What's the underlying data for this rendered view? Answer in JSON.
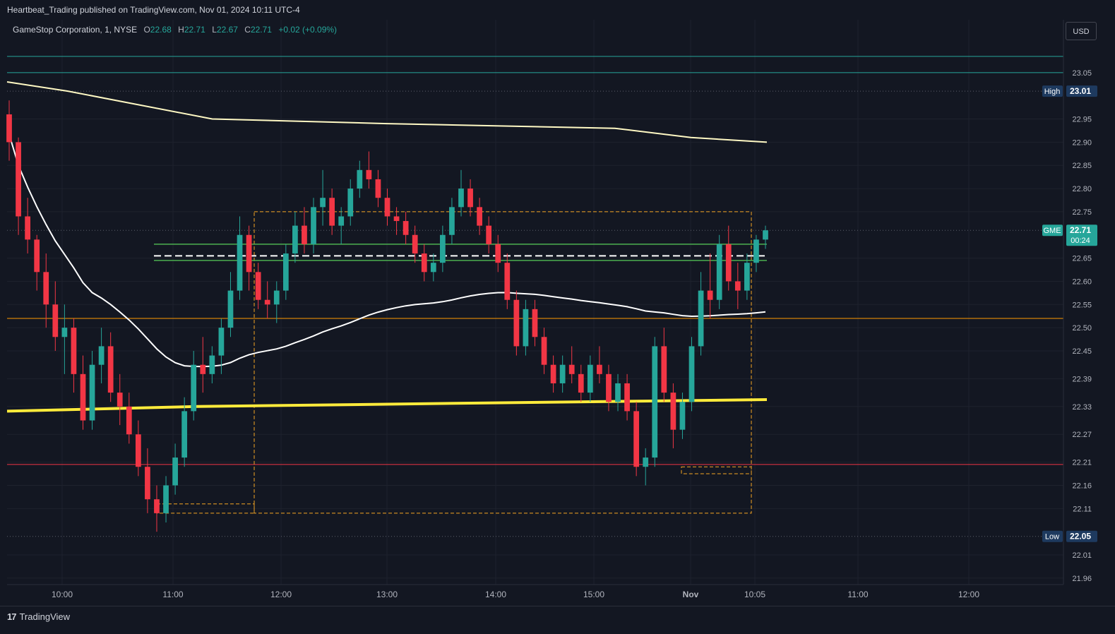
{
  "header": {
    "publisher_line": "Heartbeat_Trading published on TradingView.com, Nov 01, 2024 10:11 UTC-4"
  },
  "legend": {
    "symbol": "GameStop Corporation, 1, NYSE",
    "o_label": "O",
    "o_value": "22.68",
    "h_label": "H",
    "h_value": "22.71",
    "l_label": "L",
    "l_value": "22.67",
    "c_label": "C",
    "c_value": "22.71",
    "change": "+0.02 (+0.09%)"
  },
  "currency_button": "USD",
  "footer": {
    "brand": "TradingView",
    "logo_glyph": "17"
  },
  "colors": {
    "background": "#131722",
    "up": "#26a69a",
    "down": "#f23645",
    "vwap_white": "#ffffff",
    "ma_yellow": "#ffeb3b",
    "box_orange": "#f5a623",
    "support_green": "#4caf50",
    "level_orange": "#ff9800",
    "level_red": "#f23645",
    "level_teal": "#26a69a"
  },
  "chart_data": {
    "type": "candlestick",
    "symbol": "GME",
    "interval": "1",
    "ylim": [
      21.94,
      23.1
    ],
    "y_ticks": [
      "23.05",
      "22.95",
      "22.90",
      "22.85",
      "22.80",
      "22.75",
      "22.65",
      "22.60",
      "22.55",
      "22.50",
      "22.45",
      "22.39",
      "22.33",
      "22.27",
      "22.21",
      "22.16",
      "22.11",
      "22.01",
      "21.96"
    ],
    "x_ticks": [
      "10:00",
      "11:00",
      "12:00",
      "13:00",
      "14:00",
      "15:00",
      "Nov",
      "10:05",
      "11:00",
      "12:00"
    ],
    "price_tags": {
      "high": {
        "label": "High",
        "value": "23.01"
      },
      "last": {
        "label": "GME",
        "value": "22.71",
        "countdown": "00:24"
      },
      "low": {
        "label": "Low",
        "value": "22.05"
      }
    },
    "horizontal_levels": [
      {
        "price": 23.085,
        "color": "teal"
      },
      {
        "price": 23.05,
        "color": "teal"
      },
      {
        "price": 22.52,
        "color": "orange"
      },
      {
        "price": 22.205,
        "color": "red"
      }
    ],
    "support_zone": {
      "top": 22.68,
      "mid": 22.655,
      "bottom": 22.645
    },
    "boxes": [
      {
        "from": "10:50",
        "to": "11:45",
        "low": 22.1,
        "high": 22.12
      },
      {
        "from": "11:45",
        "to": "Nov 10:05",
        "low": 22.1,
        "high": 22.75
      },
      {
        "from": "15:55",
        "to": "Nov 10:05",
        "low": 22.185,
        "high": 22.2
      }
    ],
    "series": [
      {
        "type": "candles",
        "points": [
          [
            22.96,
            22.99,
            22.86,
            22.9
          ],
          [
            22.9,
            22.91,
            22.7,
            22.74
          ],
          [
            22.74,
            22.78,
            22.66,
            22.69
          ],
          [
            22.69,
            22.7,
            22.58,
            22.62
          ],
          [
            22.62,
            22.66,
            22.5,
            22.55
          ],
          [
            22.55,
            22.6,
            22.45,
            22.48
          ],
          [
            22.48,
            22.55,
            22.4,
            22.5
          ],
          [
            22.5,
            22.52,
            22.36,
            22.4
          ],
          [
            22.4,
            22.44,
            22.28,
            22.3
          ],
          [
            22.3,
            22.45,
            22.28,
            22.42
          ],
          [
            22.42,
            22.5,
            22.38,
            22.46
          ],
          [
            22.46,
            22.49,
            22.34,
            22.36
          ],
          [
            22.36,
            22.4,
            22.29,
            22.33
          ],
          [
            22.33,
            22.36,
            22.25,
            22.27
          ],
          [
            22.27,
            22.3,
            22.18,
            22.2
          ],
          [
            22.2,
            22.24,
            22.1,
            22.13
          ],
          [
            22.13,
            22.16,
            22.06,
            22.1
          ],
          [
            22.1,
            22.18,
            22.08,
            22.16
          ],
          [
            22.16,
            22.25,
            22.14,
            22.22
          ],
          [
            22.22,
            22.35,
            22.2,
            22.32
          ],
          [
            22.32,
            22.45,
            22.3,
            22.42
          ],
          [
            22.42,
            22.48,
            22.36,
            22.4
          ],
          [
            22.4,
            22.46,
            22.38,
            22.44
          ],
          [
            22.44,
            22.52,
            22.4,
            22.5
          ],
          [
            22.5,
            22.62,
            22.48,
            22.58
          ],
          [
            22.58,
            22.74,
            22.56,
            22.7
          ],
          [
            22.7,
            22.72,
            22.58,
            22.62
          ],
          [
            22.62,
            22.64,
            22.54,
            22.56
          ],
          [
            22.56,
            22.6,
            22.52,
            22.55
          ],
          [
            22.55,
            22.6,
            22.51,
            22.58
          ],
          [
            22.58,
            22.68,
            22.56,
            22.66
          ],
          [
            22.66,
            22.75,
            22.64,
            22.72
          ],
          [
            22.72,
            22.76,
            22.66,
            22.68
          ],
          [
            22.68,
            22.78,
            22.66,
            22.76
          ],
          [
            22.76,
            22.84,
            22.72,
            22.78
          ],
          [
            22.78,
            22.8,
            22.7,
            22.72
          ],
          [
            22.72,
            22.76,
            22.68,
            22.74
          ],
          [
            22.74,
            22.82,
            22.72,
            22.8
          ],
          [
            22.8,
            22.86,
            22.78,
            22.84
          ],
          [
            22.84,
            22.88,
            22.8,
            22.82
          ],
          [
            22.82,
            22.84,
            22.76,
            22.78
          ],
          [
            22.78,
            22.8,
            22.72,
            22.74
          ],
          [
            22.74,
            22.76,
            22.7,
            22.73
          ],
          [
            22.73,
            22.75,
            22.68,
            22.7
          ],
          [
            22.7,
            22.72,
            22.64,
            22.66
          ],
          [
            22.66,
            22.68,
            22.6,
            22.62
          ],
          [
            22.62,
            22.66,
            22.6,
            22.64
          ],
          [
            22.64,
            22.72,
            22.62,
            22.7
          ],
          [
            22.7,
            22.78,
            22.68,
            22.76
          ],
          [
            22.76,
            22.84,
            22.74,
            22.8
          ],
          [
            22.8,
            22.82,
            22.74,
            22.76
          ],
          [
            22.76,
            22.78,
            22.7,
            22.72
          ],
          [
            22.72,
            22.74,
            22.66,
            22.68
          ],
          [
            22.68,
            22.7,
            22.62,
            22.64
          ],
          [
            22.64,
            22.66,
            22.54,
            22.56
          ],
          [
            22.56,
            22.58,
            22.44,
            22.46
          ],
          [
            22.46,
            22.56,
            22.44,
            22.54
          ],
          [
            22.54,
            22.56,
            22.46,
            22.48
          ],
          [
            22.48,
            22.5,
            22.4,
            22.42
          ],
          [
            22.42,
            22.44,
            22.36,
            22.38
          ],
          [
            22.38,
            22.44,
            22.36,
            22.42
          ],
          [
            22.42,
            22.46,
            22.38,
            22.4
          ],
          [
            22.4,
            22.42,
            22.34,
            22.36
          ],
          [
            22.36,
            22.44,
            22.34,
            22.42
          ],
          [
            22.42,
            22.46,
            22.38,
            22.4
          ],
          [
            22.4,
            22.42,
            22.32,
            22.34
          ],
          [
            22.34,
            22.4,
            22.32,
            22.38
          ],
          [
            22.38,
            22.4,
            22.3,
            22.32
          ],
          [
            22.32,
            22.34,
            22.18,
            22.2
          ],
          [
            22.2,
            22.24,
            22.16,
            22.22
          ],
          [
            22.22,
            22.48,
            22.2,
            22.46
          ],
          [
            22.46,
            22.5,
            22.34,
            22.36
          ],
          [
            22.36,
            22.38,
            22.24,
            22.28
          ],
          [
            22.28,
            22.36,
            22.26,
            22.34
          ],
          [
            22.34,
            22.48,
            22.32,
            22.46
          ],
          [
            22.46,
            22.62,
            22.44,
            22.58
          ],
          [
            22.58,
            22.66,
            22.52,
            22.56
          ],
          [
            22.56,
            22.7,
            22.54,
            22.68
          ],
          [
            22.68,
            22.72,
            22.58,
            22.6
          ],
          [
            22.6,
            22.64,
            22.54,
            22.58
          ],
          [
            22.58,
            22.66,
            22.56,
            22.64
          ],
          [
            22.64,
            22.7,
            22.62,
            22.69
          ],
          [
            22.69,
            22.72,
            22.67,
            22.71
          ]
        ]
      }
    ],
    "overlays": [
      {
        "name": "white-vwap",
        "points": [
          [
            0,
            23.03
          ],
          [
            0.08,
            23.01
          ],
          [
            0.27,
            22.95
          ],
          [
            0.5,
            22.94
          ],
          [
            0.8,
            22.93
          ],
          [
            0.9,
            22.91
          ],
          [
            1.0,
            22.9
          ]
        ]
      },
      {
        "name": "yellow-thick-ma",
        "points": [
          [
            0,
            22.32
          ],
          [
            0.25,
            22.33
          ],
          [
            0.5,
            22.335
          ],
          [
            0.75,
            22.34
          ],
          [
            1.0,
            22.345
          ]
        ]
      }
    ]
  }
}
